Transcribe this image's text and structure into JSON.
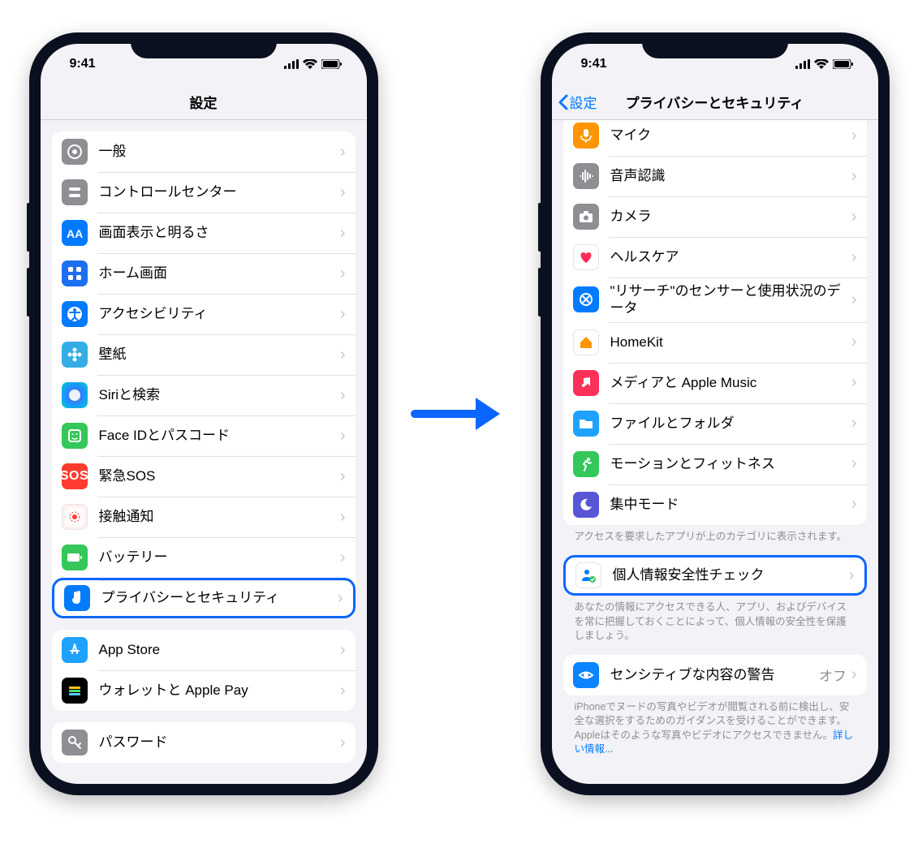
{
  "status": {
    "time": "9:41"
  },
  "arrow_label": "navigate-to",
  "phone1": {
    "nav_title": "設定",
    "groups": [
      {
        "rows": [
          {
            "key": "general",
            "label": "一般",
            "icon": "gear-icon",
            "color": "c-gray"
          },
          {
            "key": "control-center",
            "label": "コントロールセンター",
            "icon": "toggles-icon",
            "color": "c-gray2"
          },
          {
            "key": "display",
            "label": "画面表示と明るさ",
            "icon": "text-size-icon",
            "color": "c-blue"
          },
          {
            "key": "home-screen",
            "label": "ホーム画面",
            "icon": "grid-icon",
            "color": "c-bluedk"
          },
          {
            "key": "accessibility",
            "label": "アクセシビリティ",
            "icon": "accessibility-icon",
            "color": "c-blue"
          },
          {
            "key": "wallpaper",
            "label": "壁紙",
            "icon": "flower-icon",
            "color": "c-cyan"
          },
          {
            "key": "siri",
            "label": "Siriと検索",
            "icon": "siri-icon",
            "color": "c-siri"
          },
          {
            "key": "faceid",
            "label": "Face IDとパスコード",
            "icon": "faceid-icon",
            "color": "c-faceid"
          },
          {
            "key": "sos",
            "label": "緊急SOS",
            "icon": "sos-icon",
            "color": "c-sos"
          },
          {
            "key": "exposure",
            "label": "接触通知",
            "icon": "exposure-icon",
            "color": "c-white"
          },
          {
            "key": "battery",
            "label": "バッテリー",
            "icon": "battery-icon",
            "color": "c-green"
          },
          {
            "key": "privacy",
            "label": "プライバシーとセキュリティ",
            "icon": "hand-icon",
            "color": "c-blue",
            "highlight": true
          }
        ]
      },
      {
        "rows": [
          {
            "key": "appstore",
            "label": "App Store",
            "icon": "appstore-icon",
            "color": "c-appstore"
          },
          {
            "key": "wallet",
            "label": "ウォレットと Apple Pay",
            "icon": "wallet-icon",
            "color": "c-wallet"
          }
        ]
      },
      {
        "rows": [
          {
            "key": "passwords",
            "label": "パスワード",
            "icon": "key-icon",
            "color": "c-key"
          }
        ]
      }
    ]
  },
  "phone2": {
    "nav_back": "設定",
    "nav_title": "プライバシーとセキュリティ",
    "groups": [
      {
        "partial_top": true,
        "rows": [
          {
            "key": "microphone",
            "label": "マイク",
            "icon": "mic-icon",
            "color": "c-mic"
          },
          {
            "key": "speech",
            "label": "音声認識",
            "icon": "waveform-icon",
            "color": "c-gray"
          },
          {
            "key": "camera",
            "label": "カメラ",
            "icon": "camera-icon",
            "color": "c-camera"
          },
          {
            "key": "health",
            "label": "ヘルスケア",
            "icon": "heart-icon",
            "color": "c-heart"
          },
          {
            "key": "research",
            "label": "\"リサーチ\"のセンサーと使用状況のデータ",
            "icon": "research-icon",
            "color": "c-research"
          },
          {
            "key": "homekit",
            "label": "HomeKit",
            "icon": "home-icon",
            "color": "c-homekit"
          },
          {
            "key": "media",
            "label": "メディアと Apple Music",
            "icon": "music-icon",
            "color": "c-music"
          },
          {
            "key": "files",
            "label": "ファイルとフォルダ",
            "icon": "folder-icon",
            "color": "c-folder"
          },
          {
            "key": "motion",
            "label": "モーションとフィットネス",
            "icon": "motion-icon",
            "color": "c-motion"
          },
          {
            "key": "focus",
            "label": "集中モード",
            "icon": "moon-icon",
            "color": "c-focus"
          }
        ],
        "footer": "アクセスを要求したアプリが上のカテゴリに表示されます。"
      },
      {
        "rows": [
          {
            "key": "safety-check",
            "label": "個人情報安全性チェック",
            "icon": "person-check-icon",
            "color": "c-person",
            "highlight": true
          }
        ],
        "footer": "あなたの情報にアクセスできる人、アプリ、およびデバイスを常に把握しておくことによって、個人情報の安全性を保護しましょう。"
      },
      {
        "rows": [
          {
            "key": "sensitive",
            "label": "センシティブな内容の警告",
            "icon": "eye-icon",
            "color": "c-eye",
            "value": "オフ"
          }
        ],
        "footer": "iPhoneでヌードの写真やビデオが閲覧される前に検出し、安全な選択をするためのガイダンスを受けることができます。Appleはそのような写真やビデオにアクセスできません。",
        "footer_link": "詳しい情報..."
      }
    ]
  }
}
